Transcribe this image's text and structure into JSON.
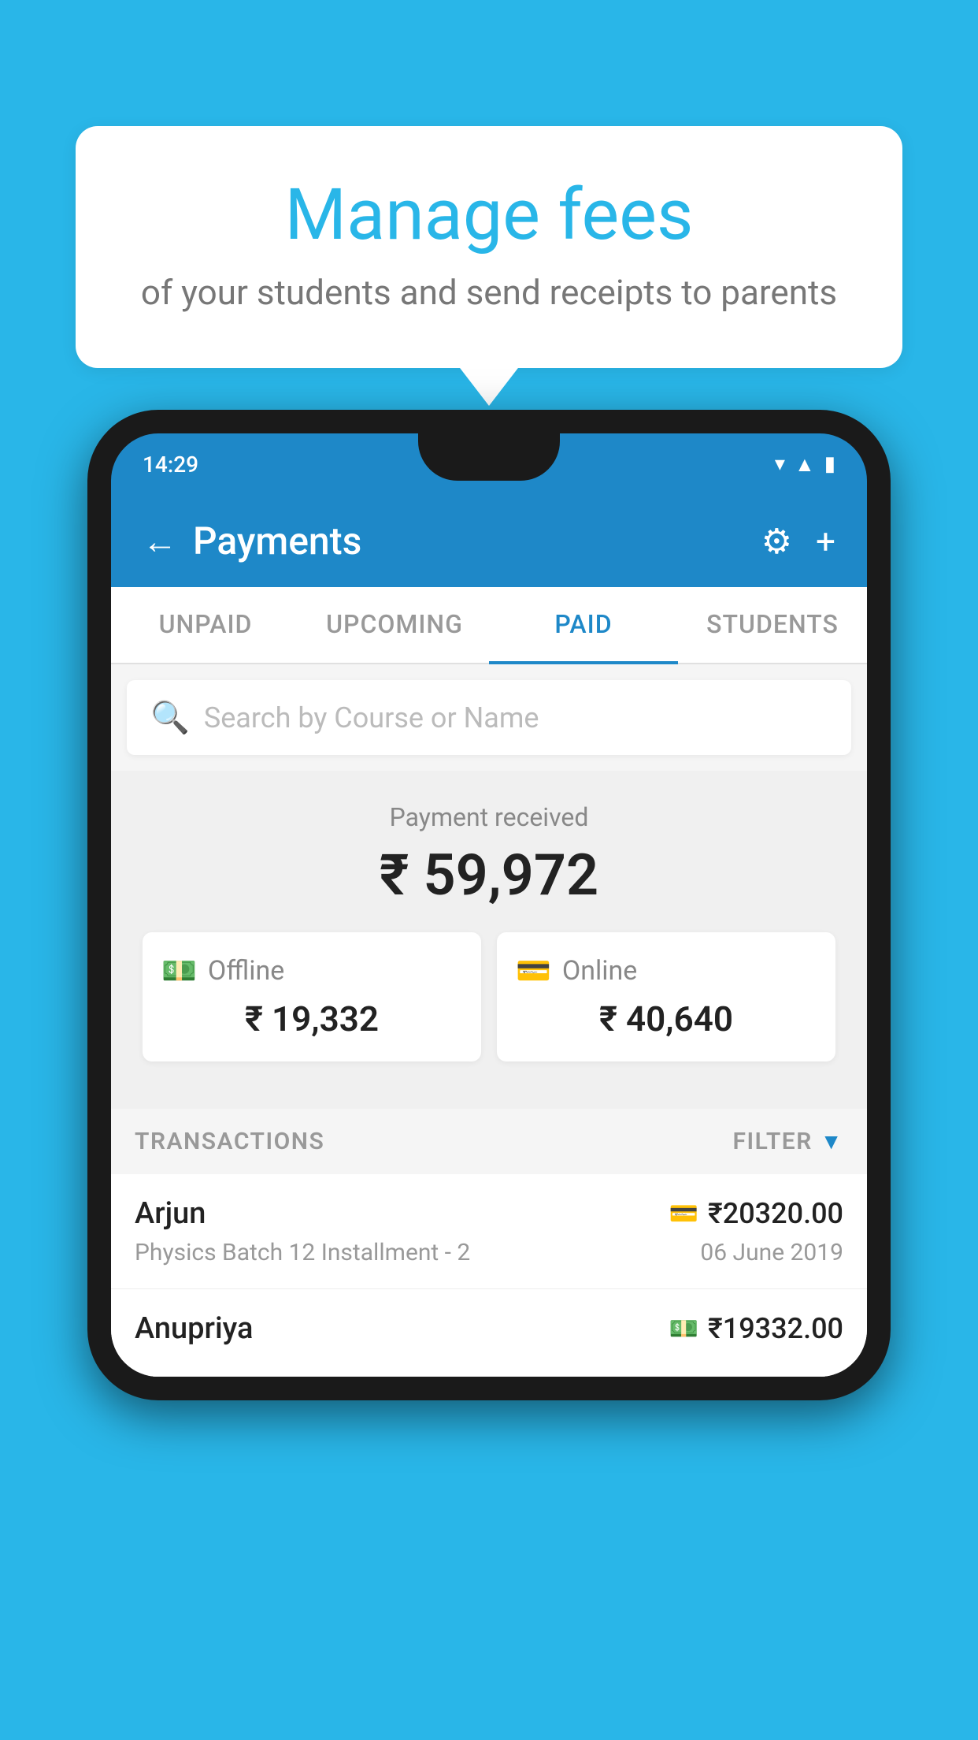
{
  "background_color": "#29b6e8",
  "bubble": {
    "title": "Manage fees",
    "subtitle": "of your students and send receipts to parents"
  },
  "phone": {
    "status_time": "14:29"
  },
  "header": {
    "title": "Payments",
    "back_label": "←",
    "gear_label": "⚙",
    "plus_label": "+"
  },
  "tabs": [
    {
      "label": "UNPAID",
      "active": false
    },
    {
      "label": "UPCOMING",
      "active": false
    },
    {
      "label": "PAID",
      "active": true
    },
    {
      "label": "STUDENTS",
      "active": false
    }
  ],
  "search": {
    "placeholder": "Search by Course or Name"
  },
  "payment_summary": {
    "received_label": "Payment received",
    "total_amount": "₹ 59,972",
    "offline_label": "Offline",
    "offline_amount": "₹ 19,332",
    "online_label": "Online",
    "online_amount": "₹ 40,640"
  },
  "transactions": {
    "section_label": "TRANSACTIONS",
    "filter_label": "FILTER",
    "rows": [
      {
        "name": "Arjun",
        "amount": "₹20320.00",
        "method_icon": "card",
        "course": "Physics Batch 12 Installment - 2",
        "date": "06 June 2019"
      },
      {
        "name": "Anupriya",
        "amount": "₹19332.00",
        "method_icon": "cash",
        "course": "",
        "date": ""
      }
    ]
  }
}
